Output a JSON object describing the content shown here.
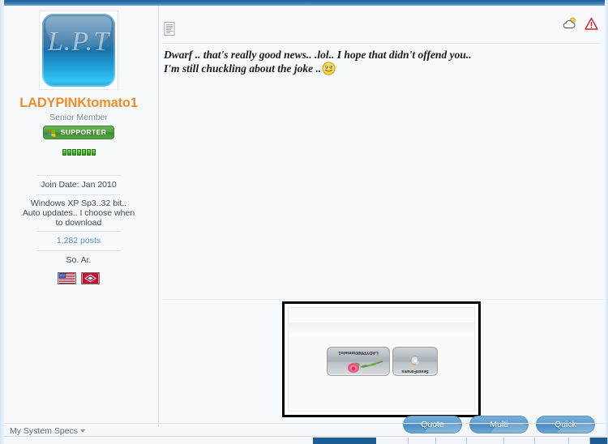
{
  "user": {
    "avatar_monogram": "L.P.T",
    "avatar_name": "user-avatar",
    "username": "LADYPINKtomato1",
    "username_color": "#ee8c2b",
    "title": "Senior Member",
    "supporter_badge": "SUPPORTER",
    "reputation_segments": 7,
    "join_date": "Join Date: Jan 2010",
    "system_specs_text": "Windows XP Sp3..32 bit.. Auto updates.. I choose when to download",
    "post_count": "1,282 posts",
    "location": "So. Ar.",
    "flags": [
      {
        "name": "flag-united-states",
        "label": "United States"
      },
      {
        "name": "flag-arkansas",
        "label": "Arkansas"
      }
    ]
  },
  "message": {
    "post_icon": "post-document-icon",
    "line1": "Dwarf .. that's really good news.. .lol.. I hope that didn't offend you..",
    "line2": "I'm still chuckling about the joke ..",
    "smiley": "smiley-grin-icon",
    "header_icons": [
      {
        "name": "weather-cloud-icon",
        "title": "Weather"
      },
      {
        "name": "report-warning-icon",
        "title": "Report Post"
      }
    ]
  },
  "attachment": {
    "name": "attached-screenshot-thumbnail",
    "taskbar_buttons": [
      {
        "name": "taskbar-button-sevenforums",
        "label": "SevenForums"
      },
      {
        "name": "taskbar-button-ladypinktomato1",
        "label": "LADYPINKtomato1"
      }
    ]
  },
  "actions": [
    {
      "name": "quote-button",
      "label": "Quote"
    },
    {
      "name": "multi-quote-button",
      "label": "Multi"
    },
    {
      "name": "quick-reply-button",
      "label": "Quick"
    }
  ],
  "footer": {
    "system_specs_link": "My System Specs"
  },
  "colors": {
    "header_blue": "#2d6fa8",
    "username_orange": "#ee8c2b",
    "button_blue": "#5d9bcb",
    "supporter_green": "#4e9c3f",
    "link_blue": "#5b8fb9"
  }
}
